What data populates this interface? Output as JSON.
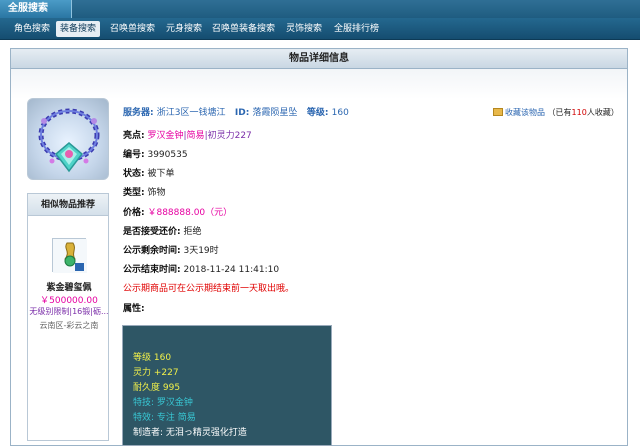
{
  "top": {
    "title": "全服搜索"
  },
  "nav": {
    "items": [
      "角色搜索",
      "装备搜索",
      "召唤兽搜索",
      "元身搜索",
      "召唤兽装备搜索",
      "灵饰搜索",
      "全服排行榜"
    ],
    "active": 1
  },
  "panel": {
    "title": "物品详细信息"
  },
  "header": {
    "server_label": "服务器:",
    "server_value": "浙江3区一钱塘江",
    "id_label": "ID:",
    "id_value": "落霞陨星坠",
    "level_label": "等级:",
    "level_value": "160",
    "favorite_link": "收藏该物品",
    "favorite_prefix": "（已有",
    "favorite_count": "110",
    "favorite_suffix": "人收藏）"
  },
  "details": {
    "highlight_label": "亮点:",
    "highlight_1": "罗汉金钟",
    "highlight_sep1": "|",
    "highlight_2": "简易",
    "highlight_sep2": "|",
    "highlight_3": "初灵力227",
    "code_label": "编号:",
    "code_value": "3990535",
    "status_label": "状态:",
    "status_value": "被下单",
    "type_label": "类型:",
    "type_value": "饰物",
    "price_label": "价格:",
    "price_value": "￥888888.00（元）",
    "bargain_label": "是否接受还价:",
    "bargain_value": "拒绝",
    "remain_label": "公示剩余时间:",
    "remain_value": "3天19时",
    "end_label": "公示结束时间:",
    "end_value": "2018-11-24 11:41:10",
    "notice": "公示期商品可在公示期结束前一天取出哦。",
    "attr_label": "属性:"
  },
  "attributes": [
    {
      "text": "等级 160",
      "color": "#f1f04a"
    },
    {
      "text": "灵力 +227",
      "color": "#f1f04a"
    },
    {
      "text": "耐久度 995",
      "color": "#f1f04a"
    },
    {
      "text": "特技: 罗汉金钟",
      "color": "#38c7d4"
    },
    {
      "text": "特效: 专注 简易",
      "color": "#38c7d4"
    },
    {
      "text": "制造者: 无泪っ精灵强化打造",
      "color": "#ffffff"
    }
  ],
  "similar": {
    "title": "相似物品推荐",
    "name": "紫金碧玺佩",
    "price": "￥500000.00",
    "tags": "无级别限制|16锻|砺...",
    "server": "云南区-彩云之南"
  },
  "colors": {
    "nav_bg": "#1a4f72",
    "price_pink": "#e600a1",
    "attr_bg": "#2e5665"
  }
}
